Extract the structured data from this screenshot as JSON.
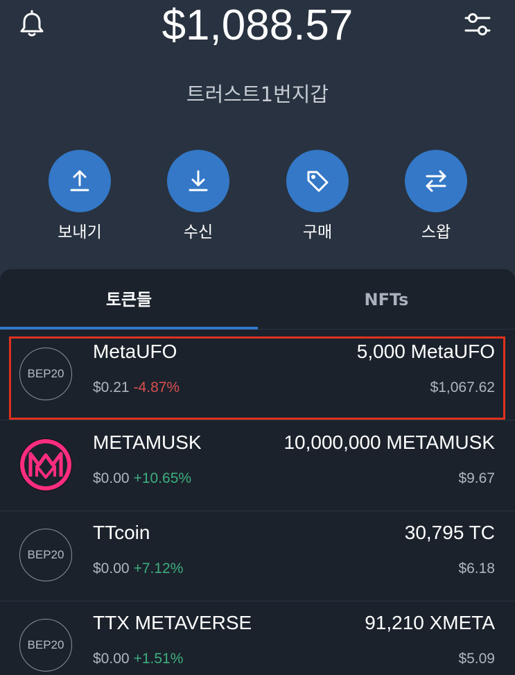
{
  "header": {
    "balance": "$1,088.57",
    "wallet_name": "트러스트1번지갑",
    "icons": {
      "left": "bell-icon",
      "right": "settings-sliders-icon"
    }
  },
  "actions": [
    {
      "label": "보내기",
      "icon": "send-arrow-up-icon"
    },
    {
      "label": "수신",
      "icon": "receive-arrow-down-icon"
    },
    {
      "label": "구매",
      "icon": "price-tag-icon"
    },
    {
      "label": "스왑",
      "icon": "swap-arrows-icon"
    }
  ],
  "tabs": {
    "tokens": "토큰들",
    "nfts": "NFTs",
    "active": "tokens"
  },
  "tokens": [
    {
      "logo": "BEP20",
      "name": "MetaUFO",
      "price": "$0.21",
      "change": "-4.87%",
      "amount": "5,000 MetaUFO",
      "value": "$1,067.62"
    },
    {
      "logo": "metamusk-logo",
      "name": "METAMUSK",
      "price": "$0.00",
      "change": "+10.65%",
      "amount": "10,000,000 METAMUSK",
      "value": "$9.67"
    },
    {
      "logo": "BEP20",
      "name": "TTcoin",
      "price": "$0.00",
      "change": "+7.12%",
      "amount": "30,795 TC",
      "value": "$6.18"
    },
    {
      "logo": "BEP20",
      "name": "TTX METAVERSE",
      "price": "$0.00",
      "change": "+1.51%",
      "amount": "91,210 XMETA",
      "value": "$5.09"
    }
  ],
  "colors": {
    "accent": "#3478c7",
    "negative": "#d94f4f",
    "positive": "#3fae7d",
    "highlight_box": "#e0321e",
    "metamusk": "#ff2d7e"
  }
}
